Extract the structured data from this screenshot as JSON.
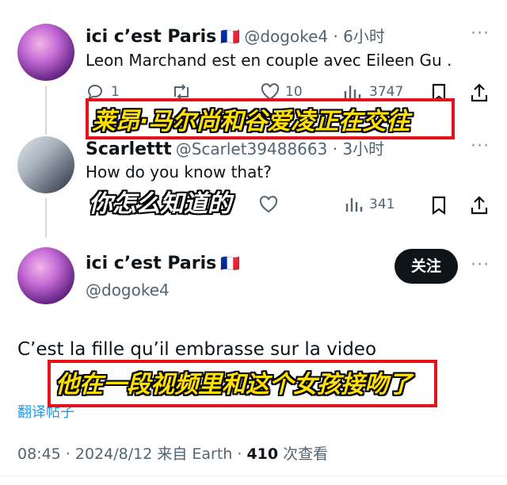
{
  "tweet1": {
    "display_name": "ici c’est Paris",
    "flag": "🇫🇷",
    "handle_time": "@dogoke4 · 6小时",
    "text": "Leon Marchand est en couple avec Eileen Gu .",
    "reply_count": "1",
    "like_count": "10",
    "view_count": "3747",
    "caption": "莱昂·马尔尚和谷爱凌正在交往"
  },
  "tweet2": {
    "display_name": "Scarlettt",
    "handle_time": "@Scarlet39488663 · 3小时",
    "text": "How do you know that?",
    "caption": "你怎么知道的",
    "view_count": "341"
  },
  "tweet3": {
    "display_name": "ici c’est Paris",
    "flag": "🇫🇷",
    "handle": "@dogoke4",
    "follow_label": "关注",
    "text": "C’est la fille qu’il embrasse sur la video",
    "caption": "他在一段视频里和这个女孩接吻了",
    "translate_link": "翻译帖子",
    "meta_time": "08:45 · 2024/8/12 来自 Earth · ",
    "meta_views": "410",
    "meta_views_label": " 次查看"
  },
  "colors": {
    "accent_link": "#1d9bf0",
    "highlight_border": "#e3131b",
    "caption_yellow": "#ffe000"
  },
  "icons": [
    "reply-icon",
    "retweet-icon",
    "like-icon",
    "views-icon",
    "bookmark-icon",
    "share-icon",
    "more-icon"
  ]
}
